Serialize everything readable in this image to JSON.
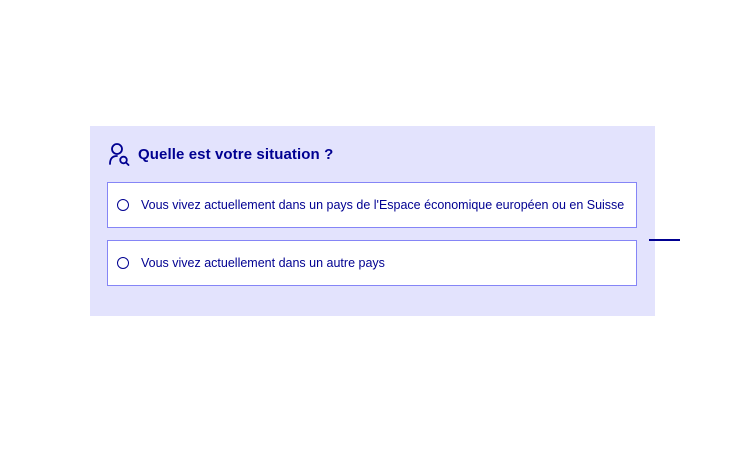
{
  "question": {
    "title": "Quelle est votre situation ?",
    "icon": "user-search-icon"
  },
  "options": [
    {
      "label": "Vous vivez actuellement dans un pays de l'Espace économique européen ou en Suisse",
      "selected": false
    },
    {
      "label": "Vous vivez actuellement dans un autre pays",
      "selected": false
    }
  ],
  "colors": {
    "accent": "#000091",
    "panel_background": "#e3e3fd",
    "option_border": "#8585f6"
  }
}
